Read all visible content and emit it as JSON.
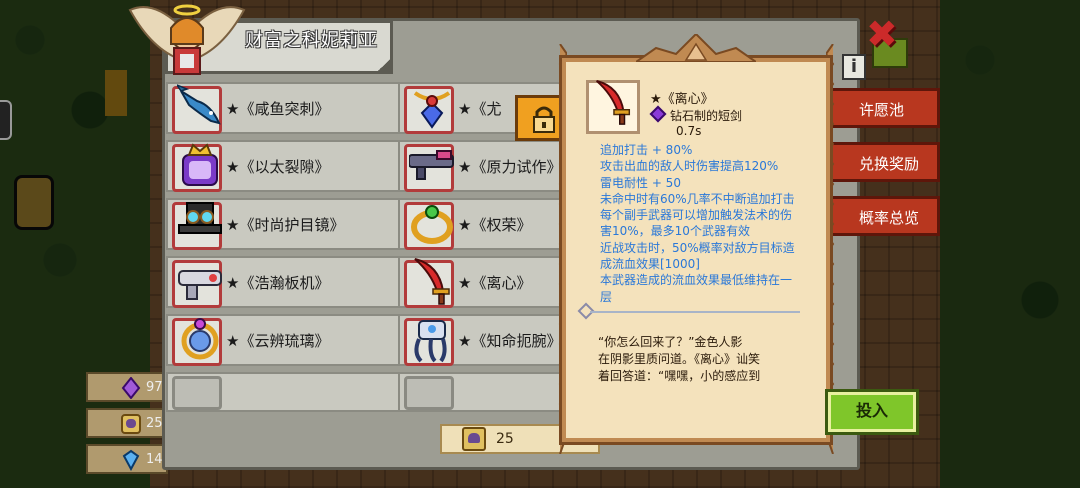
{
  "pool": {
    "title": "财富之科妮莉亚"
  },
  "items": [
    {
      "name": "★《咸鱼突刺》",
      "icon": "salted-fish-icon"
    },
    {
      "name": "★《尤",
      "icon": "ornate-amulet-icon",
      "locked": true
    },
    {
      "name": "★《以太裂隙》",
      "icon": "ether-rift-icon"
    },
    {
      "name": "★《原力试作》",
      "icon": "force-prototype-gun-icon"
    },
    {
      "name": "★《时尚护目镜》",
      "icon": "fashion-goggles-hat-icon"
    },
    {
      "name": "★《权荣》",
      "icon": "golden-ring-icon"
    },
    {
      "name": "★《浩瀚板机》",
      "icon": "vast-trigger-gun-icon"
    },
    {
      "name": "★《离心》",
      "icon": "red-dagger-icon"
    },
    {
      "name": "★《云辨琉璃》",
      "icon": "glass-ring-icon"
    },
    {
      "name": "★《知命扼腕》",
      "icon": "claw-gauntlet-icon"
    }
  ],
  "side_buttons": [
    "许愿池",
    "兑换奖励",
    "概率总览"
  ],
  "invest_button": "投入",
  "info_icon": "i",
  "currencies": [
    {
      "icon": "purple-crystal-icon",
      "value": "97"
    },
    {
      "icon": "token-icon",
      "value": "25"
    },
    {
      "icon": "blue-gem-icon",
      "value": "14"
    }
  ],
  "cost": {
    "icon": "token-icon",
    "value": "25"
  },
  "tooltip": {
    "name": "★《离心》",
    "type": "钻石制的短剑",
    "speed": "0.7s",
    "stats": [
      "追加打击 + 80%",
      "攻击出血的敌人时伤害提高120%",
      "雷电耐性 + 50",
      "未命中时有60%几率不中断追加打击",
      "每个副手武器可以增加触发法术的伤",
      "害10%，最多10个武器有效",
      "近战攻击时，50%概率对敌方目标造",
      "成流血效果[1000]",
      "本武器造成的流血效果最低维持在一",
      "层"
    ],
    "lore": [
      "  “你怎么回来了？”金色人影",
      "在阴影里质问道。《离心》讪笑",
      "着回答道：“嘿嘿，小的感应到"
    ]
  },
  "colors": {
    "stat_text": "#2a78d8",
    "invest_button": "#7fc62a",
    "side_button": "#b8371f",
    "slot_border": "#b23b3b",
    "lock_badge": "#f0a020"
  }
}
